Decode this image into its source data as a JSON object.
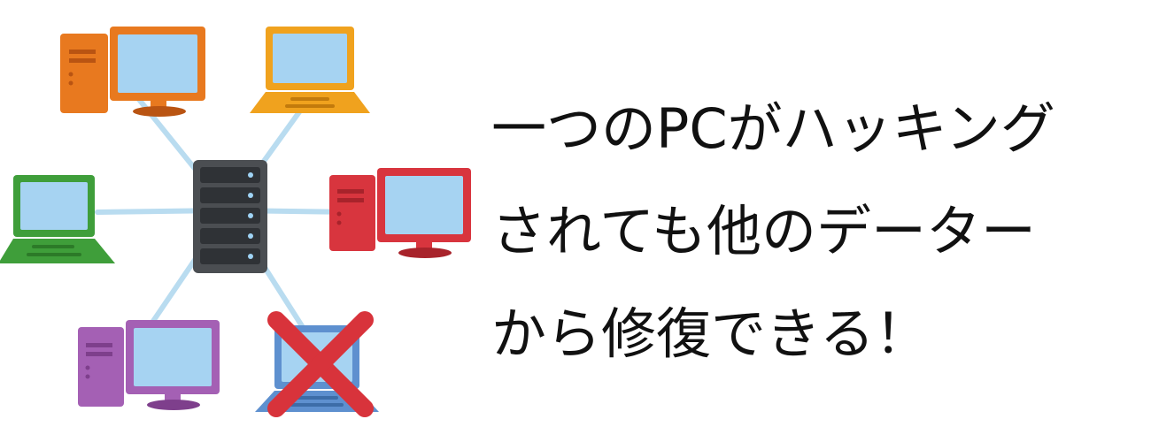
{
  "caption": {
    "lines": [
      "一つのPCがハッキング",
      "されても他のデーター",
      "から修復できる！"
    ]
  },
  "colors": {
    "link": "#b9dcf0",
    "screen": "#a6d3f2",
    "server_body": "#4b4e52",
    "server_bay": "#2f3236",
    "server_led": "#9fd3f5",
    "orange": "#e8791f",
    "orange_dark": "#b95412",
    "amber": "#f0a21e",
    "amber_dark": "#c27a0c",
    "green": "#3f9e3a",
    "green_dark": "#2c7a28",
    "red": "#d8353e",
    "red_dark": "#a8232b",
    "purple": "#a460b4",
    "purple_dark": "#7e3f8c",
    "blue": "#5e90cf",
    "blue_dark": "#3d6da8",
    "cross": "#d8333b"
  },
  "icons": {
    "center": "server-icon",
    "nodes": [
      "desktop-pc-orange-icon",
      "laptop-amber-icon",
      "laptop-green-icon",
      "desktop-pc-red-icon",
      "desktop-pc-purple-icon",
      "laptop-blue-hacked-icon"
    ],
    "hacked_marker": "cross-mark-icon"
  }
}
